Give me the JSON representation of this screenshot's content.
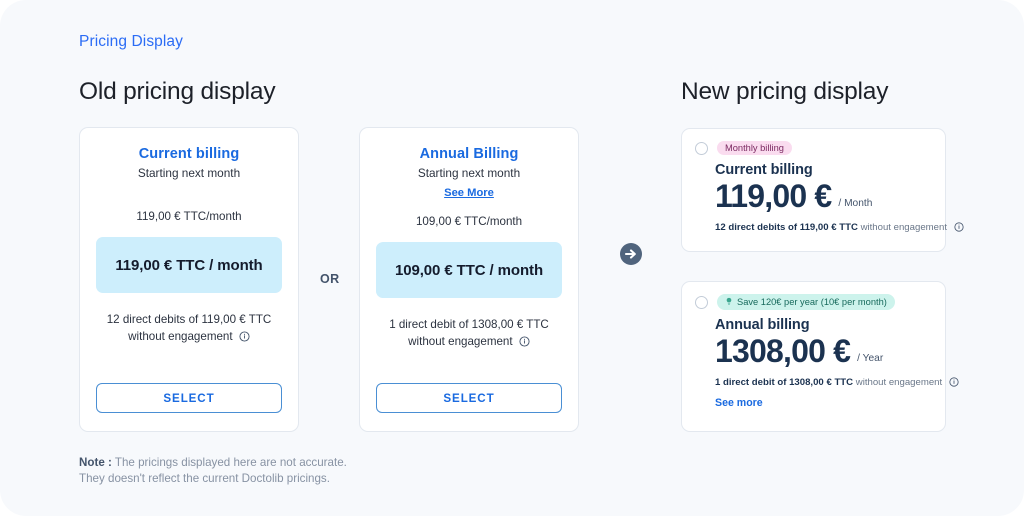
{
  "header": {
    "eyebrow": "Pricing Display",
    "old_title": "Old pricing display",
    "new_title": "New pricing display"
  },
  "separator": {
    "or_label": "OR",
    "arrow_icon": "arrow-right-circle-icon"
  },
  "old_cards": [
    {
      "title": "Current billing",
      "subtitle": "Starting next month",
      "see_more": "",
      "per_month": "119,00 € TTC/month",
      "band": "119,00 € TTC / month",
      "note_line1": "12 direct debits of 119,00 € TTC",
      "note_line2": "without engagement",
      "select_label": "SELECT"
    },
    {
      "title": "Annual Billing",
      "subtitle": "Starting next month",
      "see_more": "See More",
      "per_month": "109,00 € TTC/month",
      "band": "109,00 € TTC / month",
      "note_line1": "1 direct debit of 1308,00 € TTC",
      "note_line2": "without engagement",
      "select_label": "SELECT"
    }
  ],
  "new_cards": [
    {
      "badge": "Monthly billing",
      "badge_icon": "",
      "name": "Current billing",
      "price": "119,00 €",
      "period": "/ Month",
      "foot_bold": "12 direct debits of 119,00 € TTC",
      "foot_light": "without engagement",
      "see_more": ""
    },
    {
      "badge": "Save 120€ per year (10€ per month)",
      "badge_icon": "lightbulb-icon",
      "name": "Annual billing",
      "price": "1308,00 €",
      "period": "/ Year",
      "foot_bold": "1 direct debit of 1308,00 € TTC",
      "foot_light": "without engagement",
      "see_more": "See more"
    }
  ],
  "note": {
    "label": "Note :",
    "line1": " The pricings displayed here are not accurate.",
    "line2": "They doesn't reflect the current Doctolib pricings."
  },
  "colors": {
    "page_bg": "#f7f9fc",
    "accent_blue": "#1a6ae0",
    "eyebrow_blue": "#2b6cf5",
    "band_cyan": "#cdeefc",
    "navy": "#1b3250",
    "badge_pink_bg": "#fadcef",
    "badge_mint_bg": "#cdf3ec",
    "arrow_circle": "#50647d"
  }
}
